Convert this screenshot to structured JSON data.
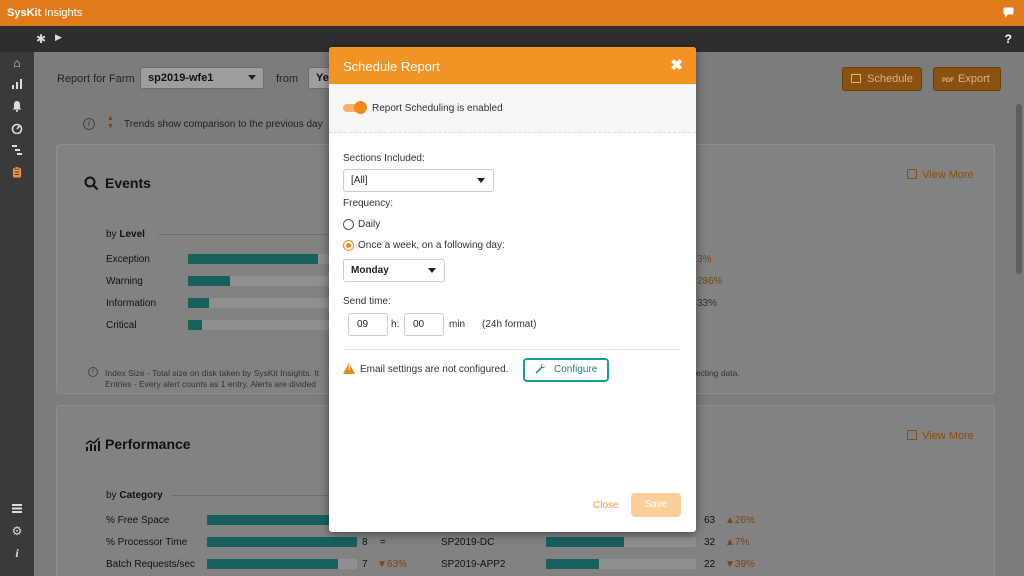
{
  "app": {
    "brand_bold": "SysKit",
    "brand_rest": " Insights",
    "chat_icon": "chat-icon",
    "help_label": "?"
  },
  "sidenav": {
    "icons": [
      "home-icon",
      "chart-icon",
      "bell-icon",
      "gauge-icon",
      "hierarchy-icon",
      "clipboard-icon",
      "list-icon",
      "gear-icon",
      "info-icon"
    ],
    "active": "clipboard-icon"
  },
  "toolbar": {
    "report_for_label": "Report for Farm",
    "farm_value": "sp2019-wfe1",
    "from_label": "from",
    "from_value": "Ye",
    "schedule_label": "Schedule",
    "export_label": "Export",
    "pdf_badge": "PDF"
  },
  "trends_note": "Trends show comparison to the previous day",
  "events": {
    "title": "Events",
    "view_more": "View More",
    "by": "by",
    "by_level": "Level",
    "rows": [
      {
        "label": "Exception",
        "fill": 0.92,
        "pct": "3%"
      },
      {
        "label": "Warning",
        "fill": 0.3,
        "pct": "286%"
      },
      {
        "label": "Information",
        "fill": 0.15,
        "pct": "33%"
      },
      {
        "label": "Critical",
        "fill": 0.1,
        "pct": ""
      }
    ],
    "note1": "Index Size -  Total size on disk taken by SysKit Insights. It",
    "note1_tail": "llecting data.",
    "note2": "Entries -  Every alert counts as 1 entry. Alerts are divided"
  },
  "performance": {
    "title": "Performance",
    "view_more": "View More",
    "by": "by",
    "by_category": "Category",
    "rows": [
      {
        "label": "% Free Space",
        "fill": 0.82,
        "value": "",
        "trend": "",
        "server": "",
        "sfill": 0.0,
        "svalue": "63",
        "strend": "▲26%"
      },
      {
        "label": "% Processor Time",
        "fill": 1.0,
        "value": "8",
        "trend": "=",
        "server": "SP2019-DC",
        "sfill": 0.52,
        "svalue": "32",
        "strend": "▲7%"
      },
      {
        "label": "Batch Requests/sec",
        "fill": 0.87,
        "value": "7",
        "trend": "▼63%",
        "server": "SP2019-APP2",
        "sfill": 0.35,
        "svalue": "22",
        "strend": "▼39%"
      }
    ]
  },
  "modal": {
    "title": "Schedule Report",
    "close_x": "✖",
    "scheduling_text": "Report Scheduling is enabled",
    "sections_label": "Sections Included:",
    "sections_value": "[All]",
    "frequency_label": "Frequency:",
    "daily_label": "Daily",
    "weekly_label": "Once a week, on a following day:",
    "day_value": "Monday",
    "send_time_label": "Send time:",
    "hours": "09",
    "hours_suffix": "h:",
    "minutes": "00",
    "minutes_suffix": "min",
    "format_note": "(24h format)",
    "email_warning": "Email settings are not configured.",
    "configure_label": "Configure",
    "close_label": "Close",
    "save_label": "Save"
  }
}
